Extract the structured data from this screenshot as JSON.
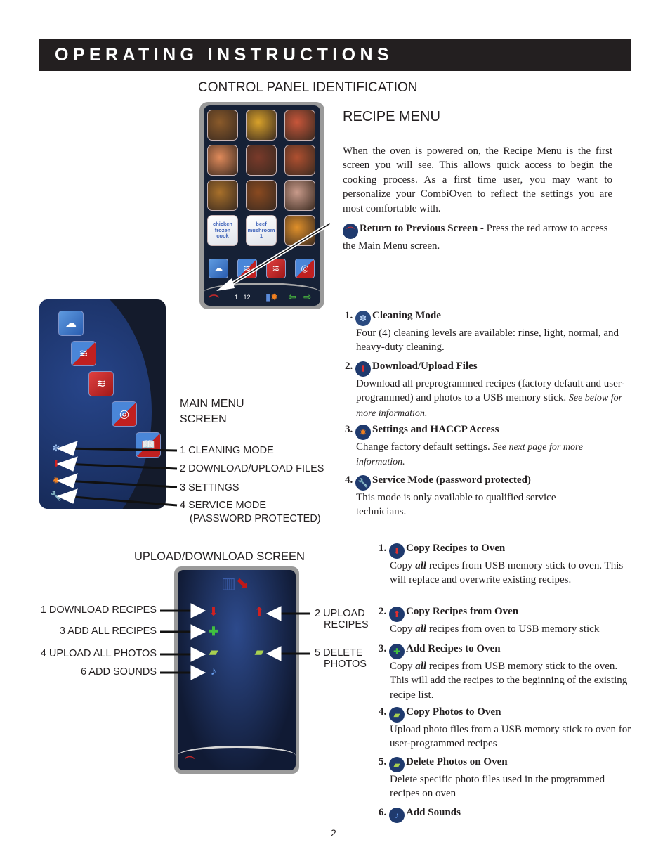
{
  "header": {
    "title": "OPERATING INSTRUCTIONS"
  },
  "section_title": "CONTROL PANEL IDENTIFICATION",
  "recipe_menu": {
    "heading": "RECIPE MENU",
    "intro": "When the oven is powered on, the Recipe Menu is the first screen you will see.  This allows quick access to begin the cooking process.  As a first time user, you may want to personalize your CombiOven to reflect the settings you are most comfortable with.",
    "return_title": "Return to Previous Screen -",
    "return_text": " Press the red arrow to access the Main Menu screen.",
    "screen": {
      "tiles": [
        {
          "type": "photo",
          "name": "roast-chicken",
          "color": "#8a5a2a"
        },
        {
          "type": "photo",
          "name": "fries",
          "color": "#d9a22a"
        },
        {
          "type": "photo",
          "name": "pizza",
          "color": "#c8563a"
        },
        {
          "type": "photo",
          "name": "salmon",
          "color": "#e08a5a"
        },
        {
          "type": "photo",
          "name": "ribs",
          "color": "#7a3a2a"
        },
        {
          "type": "photo",
          "name": "shrimp",
          "color": "#b05030"
        },
        {
          "type": "photo",
          "name": "cookies",
          "color": "#a8702a"
        },
        {
          "type": "photo",
          "name": "wings",
          "color": "#8a4a20"
        },
        {
          "type": "photo",
          "name": "roast-meat",
          "color": "#c89a8a"
        },
        {
          "type": "text",
          "label": "chicken frozen cook"
        },
        {
          "type": "text",
          "label": "beef mushroom 1"
        },
        {
          "type": "photo",
          "name": "pasta",
          "color": "#e0902a"
        }
      ],
      "mode_buttons": [
        "steam",
        "combi",
        "convection",
        "low-temp"
      ],
      "page_indicator": "1...12"
    }
  },
  "main_menu": {
    "label_line1": "MAIN MENU",
    "label_line2": "SCREEN",
    "callouts": [
      {
        "text": "1 CLEANING MODE"
      },
      {
        "text": "2 DOWNLOAD/UPLOAD FILES"
      },
      {
        "text": "3 SETTINGS"
      },
      {
        "text": "4 SERVICE MODE"
      },
      {
        "text": "(PASSWORD PROTECTED)"
      }
    ],
    "items": [
      {
        "num": "1.",
        "title": "Cleaning Mode",
        "text": "Four (4) cleaning levels are available: rinse, light, normal, and heavy-duty cleaning.",
        "italic": ""
      },
      {
        "num": "2.",
        "title": "Download/Upload Files",
        "text": "Download all preprogrammed recipes (factory default and user-programmed) and photos to a USB memory stick. ",
        "italic": "See below for more information."
      },
      {
        "num": "3.",
        "title": "Settings and HACCP Access",
        "text": "Change factory default settings. ",
        "italic": "See next page for more information."
      },
      {
        "num": "4.",
        "title": "Service Mode (password protected)",
        "text": "This mode is only available to qualified service technicians.",
        "italic": ""
      }
    ]
  },
  "upload_download": {
    "heading": "UPLOAD/DOWNLOAD SCREEN",
    "callouts_left": [
      "1 DOWNLOAD RECIPES",
      "3 ADD ALL RECIPES",
      "4 UPLOAD ALL PHOTOS",
      "6 ADD SOUNDS"
    ],
    "callouts_right": [
      {
        "line1": "2 UPLOAD",
        "line2": "RECIPES"
      },
      {
        "line1": "5 DELETE",
        "line2": "PHOTOS"
      }
    ],
    "items": [
      {
        "num": "1.",
        "title": "Copy Recipes to Oven",
        "pre": "Copy ",
        "em": "all",
        "post": " recipes from USB memory stick to oven.  This will replace and overwrite existing recipes."
      },
      {
        "num": "2.",
        "title": "Copy Recipes from Oven",
        "pre": "Copy ",
        "em": "all",
        "post": " recipes from oven to USB memory stick"
      },
      {
        "num": "3.",
        "title": "Add Recipes to Oven",
        "pre": "Copy ",
        "em": "all",
        "post": " recipes from USB memory stick to the oven.  This will add the recipes to the beginning of the existing recipe list."
      },
      {
        "num": "4.",
        "title": "Copy Photos to Oven",
        "pre": "Upload photo files from a USB memory stick to oven for user-programmed recipes",
        "em": "",
        "post": ""
      },
      {
        "num": "5.",
        "title": "Delete Photos on Oven",
        "pre": "Delete specific photo files used in the programmed recipes on oven",
        "em": "",
        "post": ""
      },
      {
        "num": "6.",
        "title": "Add Sounds",
        "pre": "",
        "em": "",
        "post": ""
      }
    ]
  },
  "page_number": "2"
}
